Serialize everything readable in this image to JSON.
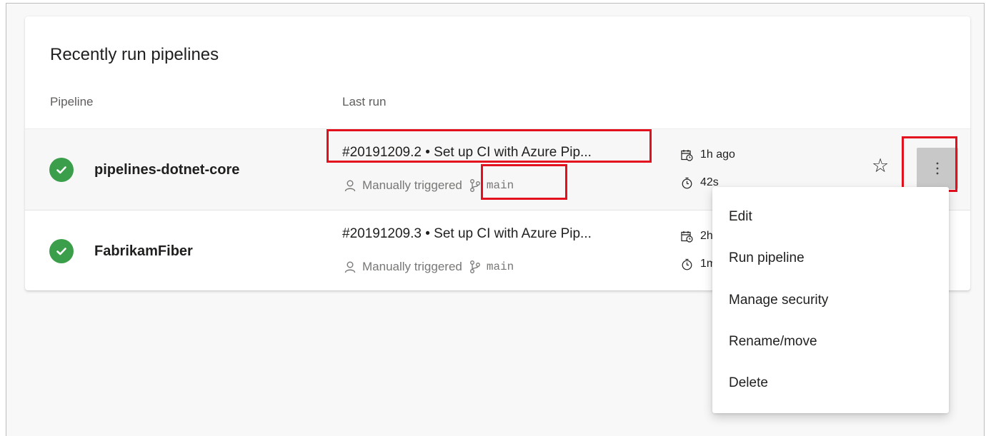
{
  "card": {
    "title": "Recently run pipelines"
  },
  "columns": {
    "pipeline": "Pipeline",
    "last_run": "Last run"
  },
  "rows": [
    {
      "name": "pipelines-dotnet-core",
      "status": "succeeded",
      "run_title": "#20191209.2 • Set up CI with Azure Pip...",
      "trigger": "Manually triggered",
      "branch": "main",
      "time_ago": "1h ago",
      "duration": "42s"
    },
    {
      "name": "FabrikamFiber",
      "status": "succeeded",
      "run_title": "#20191209.3 • Set up CI with Azure Pip...",
      "trigger": "Manually triggered",
      "branch": "main",
      "time_ago": "2h",
      "duration": "1m"
    }
  ],
  "context_menu": {
    "items": [
      "Edit",
      "Run pipeline",
      "Manage security",
      "Rename/move",
      "Delete"
    ]
  },
  "icons": {
    "status": "check-circle-icon",
    "trigger": "person-icon",
    "branch": "branch-icon",
    "calendar": "calendar-clock-icon",
    "timer": "stopwatch-icon",
    "favorite": "star-icon",
    "more": "more-vertical-icon"
  },
  "colors": {
    "success": "#3a9e4a",
    "highlight": "#e3101e",
    "more_button_bg": "#c8c8c8"
  }
}
